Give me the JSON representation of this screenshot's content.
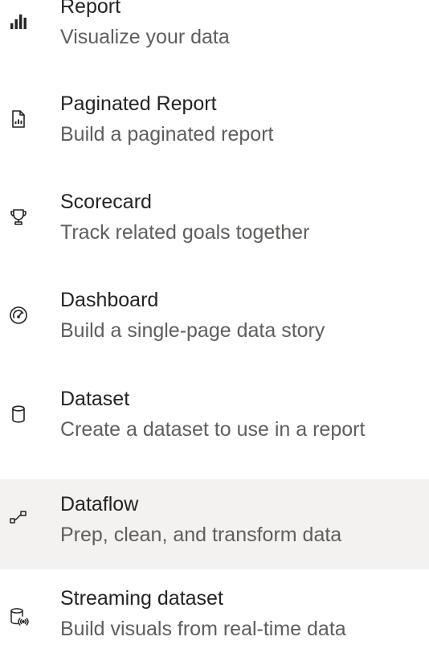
{
  "menu": {
    "items": [
      {
        "title": "Report",
        "description": "Visualize your data",
        "icon": "bar-chart-icon"
      },
      {
        "title": "Paginated Report",
        "description": "Build a paginated report",
        "icon": "paginated-report-icon"
      },
      {
        "title": "Scorecard",
        "description": "Track related goals together",
        "icon": "trophy-icon"
      },
      {
        "title": "Dashboard",
        "description": "Build a single-page data story",
        "icon": "gauge-icon"
      },
      {
        "title": "Dataset",
        "description": "Create a dataset to use in a report",
        "icon": "database-icon"
      },
      {
        "title": "Dataflow",
        "description": "Prep, clean, and transform data",
        "icon": "dataflow-icon",
        "selected": true
      },
      {
        "title": "Streaming dataset",
        "description": "Build visuals from real-time data",
        "icon": "streaming-dataset-icon"
      }
    ]
  },
  "colors": {
    "title_text": "#252423",
    "description_text": "#605e5c",
    "selected_background": "#f3f2f1",
    "icon": "#252423"
  }
}
